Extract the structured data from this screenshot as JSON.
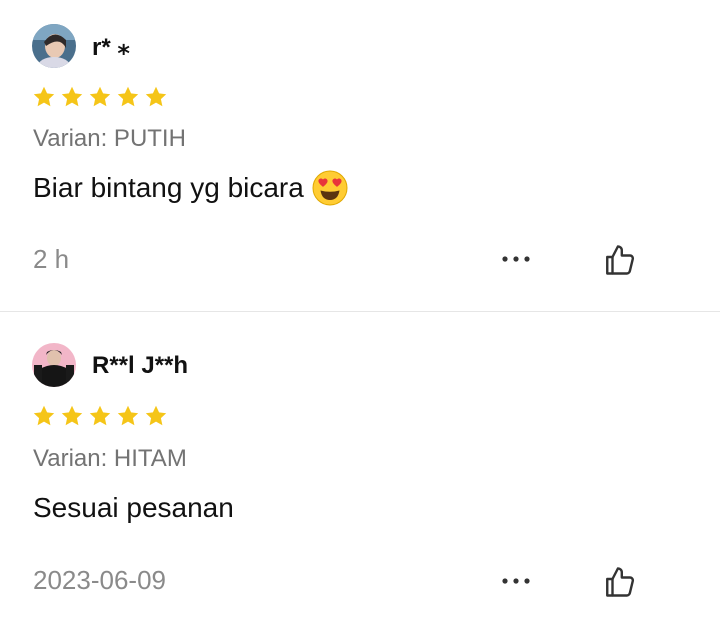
{
  "reviews": [
    {
      "username": "r* ⁎",
      "rating": 5,
      "variant": "Varian: PUTIH",
      "comment": "Biar bintang yg bicara",
      "comment_emoji": "heart-eyes-emoji",
      "time": "2 h",
      "avatar": "user-avatar-photo"
    },
    {
      "username": "R**l J**h",
      "rating": 5,
      "variant": "Varian: HITAM",
      "comment": "Sesuai pesanan",
      "time": "2023-06-09",
      "avatar": "user-avatar-photo"
    }
  ],
  "colors": {
    "star": "#F5C518",
    "muted_text": "#737373",
    "time_text": "#8a8a8a",
    "divider": "#e6e6e6",
    "icon": "#333333"
  },
  "icons": {
    "more": "more-dots-icon",
    "like": "thumbs-up-icon",
    "star": "star-icon"
  }
}
